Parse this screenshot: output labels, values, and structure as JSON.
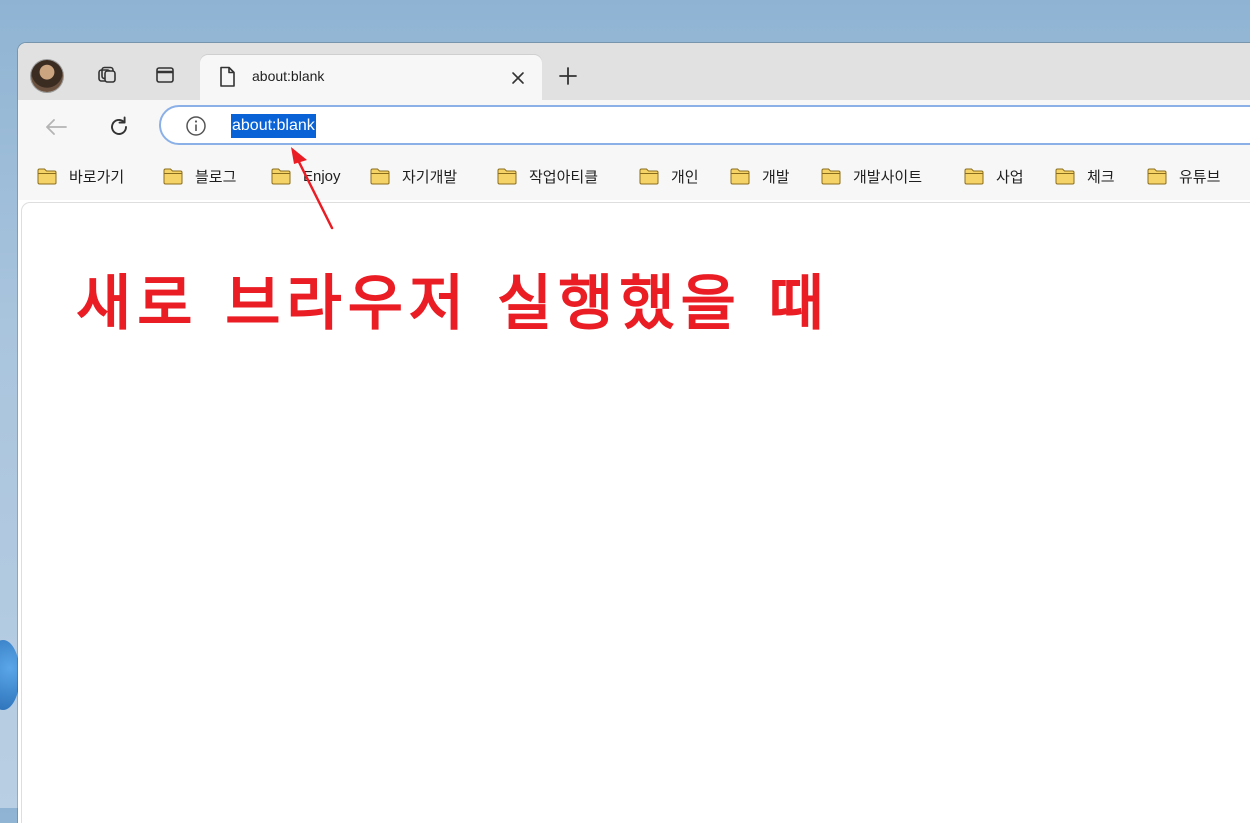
{
  "tab": {
    "title": "about:blank"
  },
  "omnibox": {
    "url": "about:blank"
  },
  "bookmarks": [
    {
      "label": "바로가기"
    },
    {
      "label": "블로그"
    },
    {
      "label": "Enjoy"
    },
    {
      "label": "자기개발"
    },
    {
      "label": "작업아티클"
    },
    {
      "label": "개인"
    },
    {
      "label": "개발"
    },
    {
      "label": "개발사이트"
    },
    {
      "label": "사업"
    },
    {
      "label": "체크"
    },
    {
      "label": "유튜브"
    }
  ],
  "annotation": {
    "text": "새로 브라우저 실행했을 때"
  },
  "colors": {
    "accent": "#0a63d6",
    "annotation": "#ea1c24",
    "folder": "#f6c64a"
  },
  "icons": {
    "profile": "avatar",
    "workspaces": "workspaces-icon",
    "vertical_tabs": "vertical-tabs-icon",
    "page": "page-icon",
    "close": "close-icon",
    "new_tab": "plus-icon",
    "back": "arrow-left-icon",
    "refresh": "refresh-icon",
    "info": "info-icon",
    "folder": "folder-icon"
  }
}
